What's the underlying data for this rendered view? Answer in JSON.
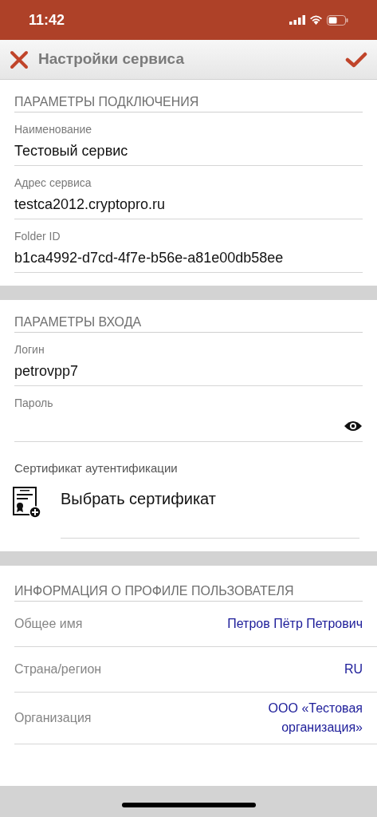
{
  "status_bar": {
    "time": "11:42"
  },
  "header": {
    "title": "Настройки сервиса"
  },
  "connection": {
    "title": "ПАРАМЕТРЫ ПОДКЛЮЧЕНИЯ",
    "fields": [
      {
        "label": "Наименование",
        "value": "Тестовый сервис"
      },
      {
        "label": "Адрес сервиса",
        "value": "testca2012.cryptopro.ru"
      },
      {
        "label": "Folder ID",
        "value": "b1ca4992-d7cd-4f7e-b56e-a81e00db58ee"
      }
    ]
  },
  "login": {
    "title": "ПАРАМЕТРЫ ВХОДА",
    "fields": [
      {
        "label": "Логин",
        "value": "petrovpp7",
        "kind": "text"
      },
      {
        "label": "Пароль",
        "kind": "password"
      }
    ],
    "certificate": {
      "label": "Сертификат аутентификации",
      "action": "Выбрать сертификат"
    }
  },
  "profile": {
    "title": "ИНФОРМАЦИЯ О ПРОФИЛЕ ПОЛЬЗОВАТЕЛЯ",
    "rows": [
      {
        "label": "Общее имя",
        "value": "Петров Пётр Петрович"
      },
      {
        "label": "Страна/регион",
        "value": "RU"
      },
      {
        "label": "Организация",
        "value": "ООО «Тестовая организация»"
      }
    ]
  }
}
